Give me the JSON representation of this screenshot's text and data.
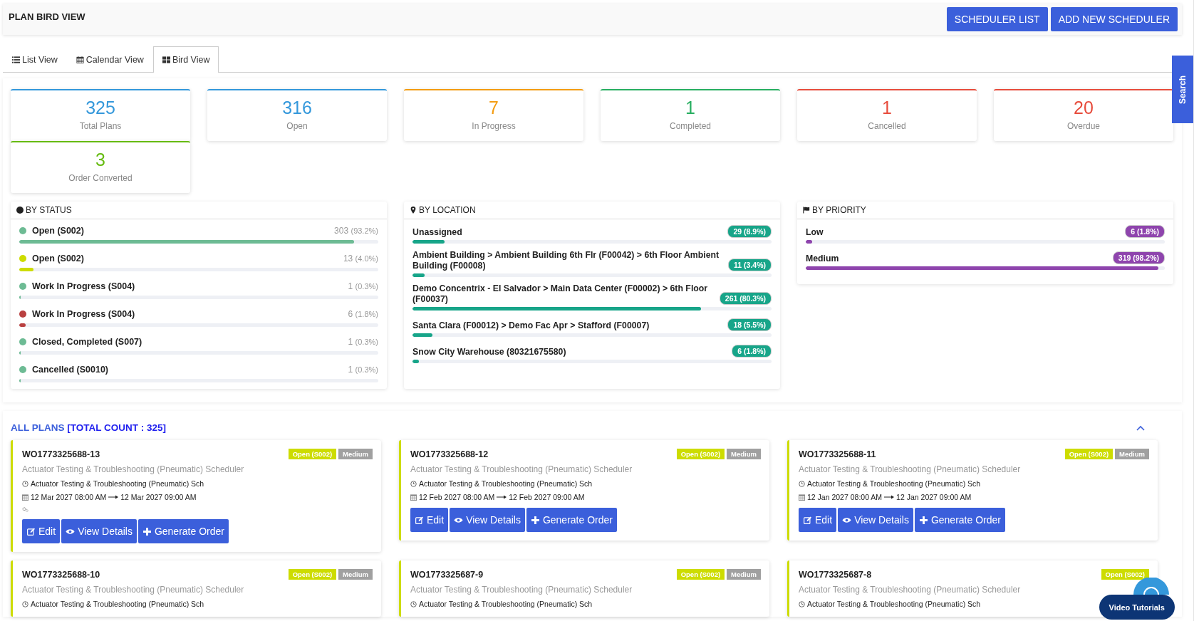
{
  "header": {
    "title": "PLAN BIRD VIEW",
    "buttons": [
      "SCHEDULER LIST",
      "ADD NEW SCHEDULER"
    ]
  },
  "tabs": [
    {
      "label": "List View",
      "kind": "list",
      "selected": false
    },
    {
      "label": "Calendar View",
      "kind": "calendar",
      "selected": false
    },
    {
      "label": "Bird View",
      "kind": "grid",
      "selected": true
    }
  ],
  "search_tab": "Search",
  "stats": [
    {
      "value": "325",
      "label": "Total Plans",
      "color": "#3498db"
    },
    {
      "value": "316",
      "label": "Open",
      "color": "#3498db"
    },
    {
      "value": "7",
      "label": "In Progress",
      "color": "#f39c12"
    },
    {
      "value": "1",
      "label": "Completed",
      "color": "#27ae60"
    },
    {
      "value": "1",
      "label": "Cancelled",
      "color": "#e74c3c"
    },
    {
      "value": "20",
      "label": "Overdue",
      "color": "#e74c3c"
    },
    {
      "value": "3",
      "label": "Order Converted",
      "color": "#66bb11"
    }
  ],
  "by_status": {
    "title": "BY STATUS",
    "items": [
      {
        "label": "Open (S002)",
        "count": "303",
        "percent": "(93.2%)",
        "color": "#6dbb94",
        "level": 0.932
      },
      {
        "label": "Open (S002)",
        "count": "13",
        "percent": "(4.0%)",
        "color": "#cddc00",
        "level": 0.04
      },
      {
        "label": "Work In Progress (S004)",
        "count": "1",
        "percent": "(0.3%)",
        "color": "#6dbb94",
        "level": 0.003
      },
      {
        "label": "Work In Progress (S004)",
        "count": "6",
        "percent": "(1.8%)",
        "color": "#b94040",
        "level": 0.018
      },
      {
        "label": "Closed, Completed (S007)",
        "count": "1",
        "percent": "(0.3%)",
        "color": "#6dbb94",
        "level": 0.003
      },
      {
        "label": "Cancelled (S0010)",
        "count": "1",
        "percent": "(0.3%)",
        "color": "#6dbb94",
        "level": 0.003
      }
    ]
  },
  "by_location": {
    "title": "BY LOCATION",
    "items": [
      {
        "label": "Unassigned",
        "count": "29 (8.9%)",
        "level": 0.089
      },
      {
        "label": "Ambient Building > Ambient Building 6th Flr (F00042) > 6th Floor Ambient Building (F00008)",
        "count": "11 (3.4%)",
        "level": 0.034
      },
      {
        "label": "Demo Concentrix - El Salvador > Main Data Center (F00002) > 6th Floor (F00037)",
        "count": "261 (80.3%)",
        "level": 0.803
      },
      {
        "label": "Santa Clara (F00012) > Demo Fac Apr > Stafford (F00007)",
        "count": "18 (5.5%)",
        "level": 0.055
      },
      {
        "label": "Snow City Warehouse (80321675580)",
        "count": "6 (1.8%)",
        "level": 0.018
      }
    ]
  },
  "by_priority": {
    "title": "BY PRIORITY",
    "items": [
      {
        "label": "Low",
        "count": "6 (1.8%)",
        "level": 0.018
      },
      {
        "label": "Medium",
        "count": "319 (98.2%)",
        "level": 0.982
      }
    ]
  },
  "plans": {
    "title": "ALL PLANS",
    "count": "[TOTAL COUNT : 325]",
    "expanded": true,
    "cards": [
      {
        "id": "WO1773325688-13",
        "status": "Open (S002)",
        "color": "#cddc00",
        "priority": "Medium",
        "name": "Actuator Testing & Troubleshooting (Pneumatic) Scheduler",
        "schedule": "Actuator Testing & Troubleshooting (Pneumatic) Sch",
        "start": "12 Mar 2027 08:00 AM",
        "end": "12 Mar 2027 09:00 AM",
        "extra_icon": true,
        "actions": [
          {
            "label": "Edit",
            "kind": "edit"
          },
          {
            "label": "View Details",
            "kind": "view"
          },
          {
            "label": "Generate Order",
            "kind": "generate"
          }
        ]
      },
      {
        "id": "WO1773325688-12",
        "status": "Open (S002)",
        "color": "#cddc00",
        "priority": "Medium",
        "name": "Actuator Testing & Troubleshooting (Pneumatic) Scheduler",
        "schedule": "Actuator Testing & Troubleshooting (Pneumatic) Sch",
        "start": "12 Feb 2027 08:00 AM",
        "end": "12 Feb 2027 09:00 AM",
        "extra_icon": false,
        "actions": [
          {
            "label": "Edit",
            "kind": "edit"
          },
          {
            "label": "View Details",
            "kind": "view"
          },
          {
            "label": "Generate Order",
            "kind": "generate"
          }
        ]
      },
      {
        "id": "WO1773325688-11",
        "status": "Open (S002)",
        "color": "#cddc00",
        "priority": "Medium",
        "name": "Actuator Testing & Troubleshooting (Pneumatic) Scheduler",
        "schedule": "Actuator Testing & Troubleshooting (Pneumatic) Sch",
        "start": "12 Jan 2027 08:00 AM",
        "end": "12 Jan 2027 09:00 AM",
        "extra_icon": false,
        "actions": [
          {
            "label": "Edit",
            "kind": "edit"
          },
          {
            "label": "View Details",
            "kind": "view"
          },
          {
            "label": "Generate Order",
            "kind": "generate"
          }
        ]
      },
      {
        "id": "WO1773325688-10",
        "status": "Open (S002)",
        "color": "#cddc00",
        "priority": "Medium",
        "name": "Actuator Testing & Troubleshooting (Pneumatic) Scheduler",
        "schedule": "Actuator Testing & Troubleshooting (Pneumatic) Sch",
        "extra_icon": false
      },
      {
        "id": "WO1773325687-9",
        "status": "Open (S002)",
        "color": "#cddc00",
        "priority": "Medium",
        "name": "Actuator Testing & Troubleshooting (Pneumatic) Scheduler",
        "schedule": "Actuator Testing & Troubleshooting (Pneumatic) Sch",
        "extra_icon": false
      },
      {
        "id": "WO1773325687-8",
        "status": "Open (S002)",
        "color": "#cddc00",
        "name": "Actuator Testing & Troubleshooting (Pneumatic) Scheduler",
        "schedule": "Actuator Testing & Troubleshooting (Pneumatic) Sch",
        "extra_icon": false
      }
    ]
  },
  "video_tutorials": "Video Tutorials"
}
